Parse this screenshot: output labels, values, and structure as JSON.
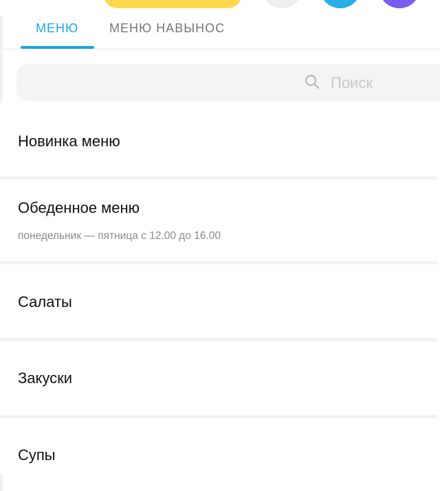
{
  "tabs": [
    {
      "label": "МЕНЮ"
    },
    {
      "label": "МЕНЮ НАВЫНОС"
    }
  ],
  "search": {
    "placeholder": "Поиск"
  },
  "categories": [
    {
      "title": "Новинка меню",
      "subtitle": ""
    },
    {
      "title": "Обеденное меню",
      "subtitle": "понедельник — пятница с 12.00 до 16.00"
    },
    {
      "title": "Салаты",
      "subtitle": ""
    },
    {
      "title": "Закуски",
      "subtitle": ""
    },
    {
      "title": "Супы",
      "subtitle": ""
    }
  ],
  "colors": {
    "accent": "#1aa6e0",
    "yellow": "#ffd84e",
    "blue": "#2aaee8",
    "purple": "#7b5cf0"
  },
  "icons": {
    "search": "search-icon"
  }
}
